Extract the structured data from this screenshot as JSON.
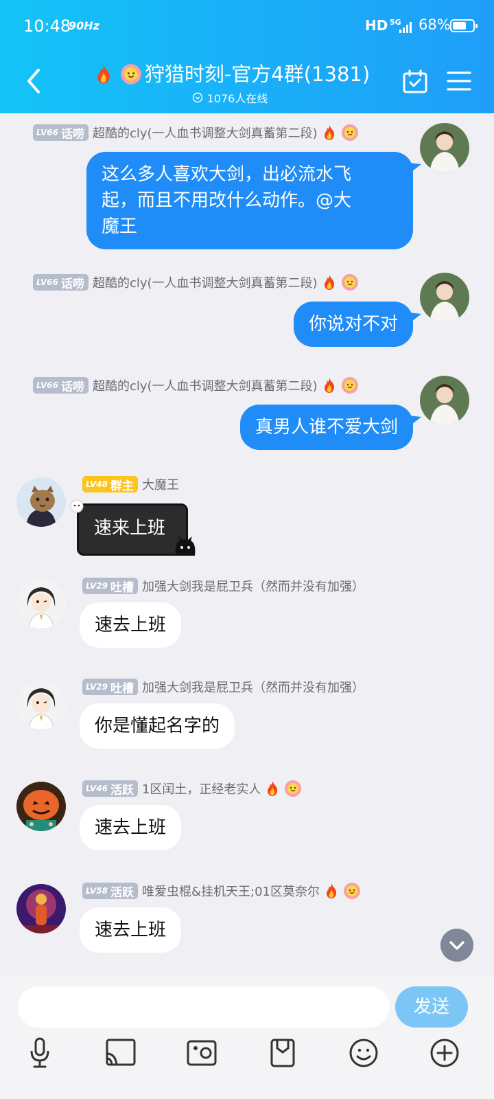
{
  "status_bar": {
    "time": "10:48",
    "refresh_rate": "90Hz",
    "hd": "HD",
    "network": "5G",
    "battery": "68%",
    "battery_level": 0.68
  },
  "header": {
    "title": "狩猎时刻-官方4群(1381)",
    "online": "1076人在线"
  },
  "messages": [
    {
      "side": "right",
      "level": "LV66",
      "tag": "话唠",
      "nick": "超酷的cly(一人血书调整大剑真蓄第二段)",
      "text": [
        "这么多人喜欢大剑，出必流水飞",
        "起，而且不用改什么动作。@大",
        "魔王"
      ]
    },
    {
      "side": "right",
      "level": "LV66",
      "tag": "话唠",
      "nick": "超酷的cly(一人血书调整大剑真蓄第二段)",
      "text": [
        "你说对不对"
      ]
    },
    {
      "side": "right",
      "level": "LV66",
      "tag": "话唠",
      "nick": "超酷的cly(一人血书调整大剑真蓄第二段)",
      "text": [
        "真男人谁不爱大剑"
      ]
    },
    {
      "side": "left",
      "level": "LV48",
      "tag": "群主",
      "nick": "大魔王",
      "text": [
        "速来上班"
      ]
    },
    {
      "side": "left",
      "level": "LV29",
      "tag": "吐槽",
      "nick": "加强大剑我是屁卫兵（然而并没有加强）",
      "text": [
        "速去上班"
      ]
    },
    {
      "side": "left",
      "level": "LV29",
      "tag": "吐槽",
      "nick": "加强大剑我是屁卫兵（然而并没有加强）",
      "text": [
        "你是懂起名字的"
      ]
    },
    {
      "side": "left",
      "level": "LV46",
      "tag": "活跃",
      "nick": "1区闰土，正经老实人",
      "text": [
        "速去上班"
      ]
    },
    {
      "side": "left",
      "level": "LV58",
      "tag": "活跃",
      "nick": "唯爱虫棍&挂机天王;01区莫奈尔",
      "text": [
        "速去上班"
      ]
    }
  ],
  "input": {
    "placeholder": "",
    "send_label": "发送"
  },
  "toolbar": [
    "mic-icon",
    "cast-icon",
    "photo-icon",
    "file-icon",
    "emoji-icon",
    "plus-icon"
  ],
  "colors": {
    "header_start": "#13c4f7",
    "header_end": "#1f9ef9",
    "my_bubble": "#1f8cf7",
    "send_button": "#7cc6f6",
    "owner_badge": "#fbc51d"
  }
}
